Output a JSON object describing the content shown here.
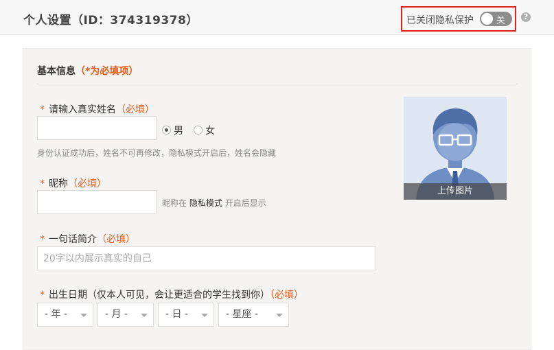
{
  "header": {
    "title": "个人设置（ID：374319378）"
  },
  "privacy": {
    "label": "已关闭隐私保护",
    "toggle_text": "关",
    "enabled": false,
    "help_icon": "?"
  },
  "form": {
    "section_title": "基本信息",
    "section_required_note": "（*为必填项）",
    "required_mark": "*",
    "required_text": "（必填）",
    "name": {
      "label": "请输入真实姓名",
      "value": "",
      "hint": "身份认证成功后，姓名不可再修改，隐私模式开启后，姓名会隐藏"
    },
    "gender": {
      "options": [
        "男",
        "女"
      ],
      "selected": "男"
    },
    "nickname": {
      "label": "昵称",
      "value": "",
      "hint_prefix": "昵称在",
      "hint_mode": "隐私模式",
      "hint_suffix": "开启后显示"
    },
    "bio": {
      "label": "一句话简介",
      "placeholder": "20字以内展示真实的自己"
    },
    "birthday": {
      "label": "出生日期（仅本人可见，会让更适合的学生找到你）",
      "selects": [
        "- 年 -",
        "- 月 -",
        "- 日 -",
        "- 星座 -"
      ]
    },
    "avatar": {
      "upload_label": "上传图片"
    }
  },
  "colors": {
    "accent": "#f05a14",
    "highlight_border": "#e02020",
    "toggle_off": "#8c8c8c"
  }
}
